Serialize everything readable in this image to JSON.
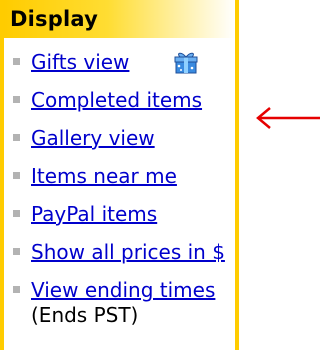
{
  "panel": {
    "title": "Display",
    "items": [
      {
        "label": "Gifts view",
        "icon": "gift-box-icon"
      },
      {
        "label": "Completed items"
      },
      {
        "label": "Gallery view"
      },
      {
        "label": "Items near me"
      },
      {
        "label": "PayPal items"
      },
      {
        "label": "Show all prices in $"
      },
      {
        "label": "View ending times",
        "note": "(Ends PST)"
      }
    ]
  },
  "annotation": {
    "icon": "left-arrow-icon",
    "color": "#e60000"
  },
  "colors": {
    "accent": "#ffcc00",
    "link": "#0000cc",
    "bullet": "#b3b3b3"
  }
}
